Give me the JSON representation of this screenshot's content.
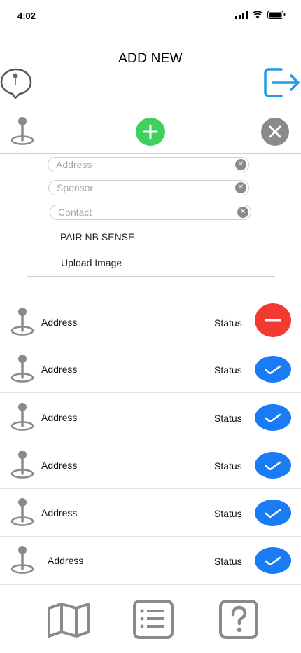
{
  "status_bar": {
    "time": "4:02"
  },
  "header": {
    "title": "ADD NEW"
  },
  "icons": {
    "location_bubble": "map-pin-speech-bubble-icon",
    "logout": "logout-icon",
    "pin": "map-pin-icon",
    "add": "plus-icon",
    "close": "close-icon"
  },
  "form": {
    "address_placeholder": "Address",
    "sponsor_placeholder": "Sponsor",
    "contact_placeholder": "Contact",
    "pair_label": "PAIR NB SENSE",
    "upload_label": "Upload Image"
  },
  "list": {
    "items": [
      {
        "address": "Address",
        "status": "Status",
        "action": "remove"
      },
      {
        "address": "Address",
        "status": "Status",
        "action": "check"
      },
      {
        "address": "Address",
        "status": "Status",
        "action": "check"
      },
      {
        "address": "Address",
        "status": "Status",
        "action": "check"
      },
      {
        "address": "Address",
        "status": "Status",
        "action": "check"
      },
      {
        "address": "Address",
        "status": "Status",
        "action": "check"
      }
    ]
  },
  "tab_bar": {
    "icons": [
      "map-icon",
      "list-icon",
      "help-icon"
    ]
  },
  "colors": {
    "accent_blue": "#1a7cf5",
    "remove_red": "#f33a32",
    "add_green": "#3fd05d",
    "icon_gray": "#8a8a8a",
    "logout_blue": "#1c9be6"
  }
}
